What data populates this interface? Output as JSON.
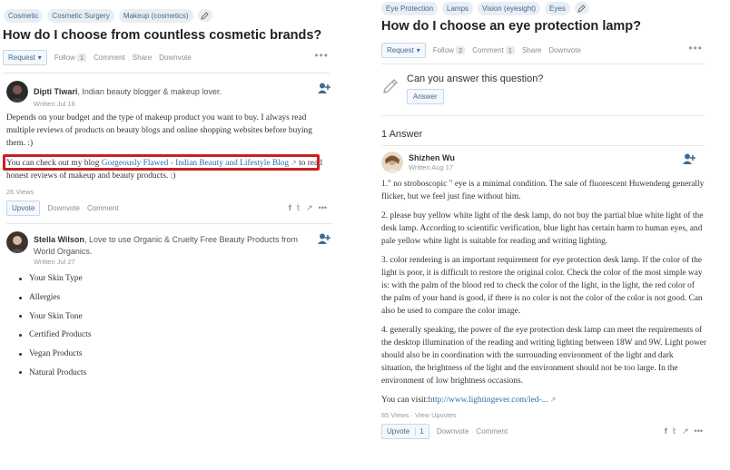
{
  "left": {
    "topics": [
      "Cosmetic",
      "Cosmetic Surgery",
      "Makeup (cosmetics)"
    ],
    "question": "How do I choose from countless cosmetic brands?",
    "actions": {
      "request": "Request",
      "follow": "Follow",
      "follow_count": "1",
      "comment": "Comment",
      "share": "Share",
      "downvote": "Downvote"
    },
    "answer1": {
      "author": "Dipti Tiwari",
      "credential": ", Indian beauty blogger & makeup lover.",
      "written": "Written Jul 16",
      "para1": "Depends on your budget and the type of makeup product you want to buy. I always read multiple reviews of products on beauty blogs and online shopping websites before buying them. :)",
      "para2_prefix": "You can check out my blog ",
      "para2_link": "Gorgeously Flawed - Indian Beauty and Lifestyle Blog",
      "para2_suffix": " to read honest reviews of makeup and beauty products. :)",
      "views": "26 Views",
      "upvote": "Upvote",
      "downvote": "Downvote",
      "comment": "Comment"
    },
    "answer2": {
      "author": "Stella Wilson",
      "credential": ", Love to use Organic & Cruelty Free Beauty Products from World Organics.",
      "written": "Written Jul 27",
      "bullets": [
        "Your Skin Type",
        "Allergies",
        "Your Skin Tone",
        "Certified Products",
        "Vegan Products",
        "Natural Products"
      ]
    }
  },
  "right": {
    "topics": [
      "Eye Protection",
      "Lamps",
      "Vision (eyesight)",
      "Eyes"
    ],
    "question": "How do I choose an eye protection lamp?",
    "actions": {
      "request": "Request",
      "follow": "Follow",
      "follow_count": "2",
      "comment": "Comment",
      "comment_count": "1",
      "share": "Share",
      "downvote": "Downvote"
    },
    "prompt": "Can you answer this question?",
    "answer_btn": "Answer",
    "answers_count": "1 Answer",
    "answer": {
      "author": "Shizhen Wu",
      "written": "Written Aug 17",
      "p1": "1.\" no stroboscopic \" eye is a minimal condition. The sale of fluorescent Huwendeng generally flicker, but we feel just fine without him.",
      "p2": "2. please buy yellow white light of the desk lamp, do not buy the partial blue white light of the desk lamp. According to scientific verification, blue light has certain harm to human eyes, and pale yellow white light is suitable for reading and writing lighting.",
      "p3": "3. color rendering is an important requirement for eye protection desk lamp. If the color of the light is poor, it is difficult to restore the original color. Check the color of the most simple way is: with the palm of the blood red to check the color of the light, in the light, the red color of the palm of your hand is good, if there is no color is not the color of the color is not good. Can also be used to compare the color image.",
      "p4": "4. generally speaking, the power of the eye protection desk lamp can meet the requirements of the desktop illumination of the reading and writing lighting between 18W and 9W. Light power should also be in coordination with the surrounding environment of the light and dark situation, the brightness of the light and the environment should not be too large. In the environment of low brightness occasions.",
      "visit_prefix": "You can visit:",
      "visit_link": "http://www.lightingever.com/led-...",
      "views": "85 Views",
      "view_upvotes": "View Upvotes",
      "upvote": "Upvote",
      "upvote_count": "1",
      "downvote": "Downvote",
      "comment": "Comment"
    }
  },
  "colors": {
    "accent": "#3f6b8f",
    "link": "#2b6dad",
    "highlight": "#c8211f"
  }
}
